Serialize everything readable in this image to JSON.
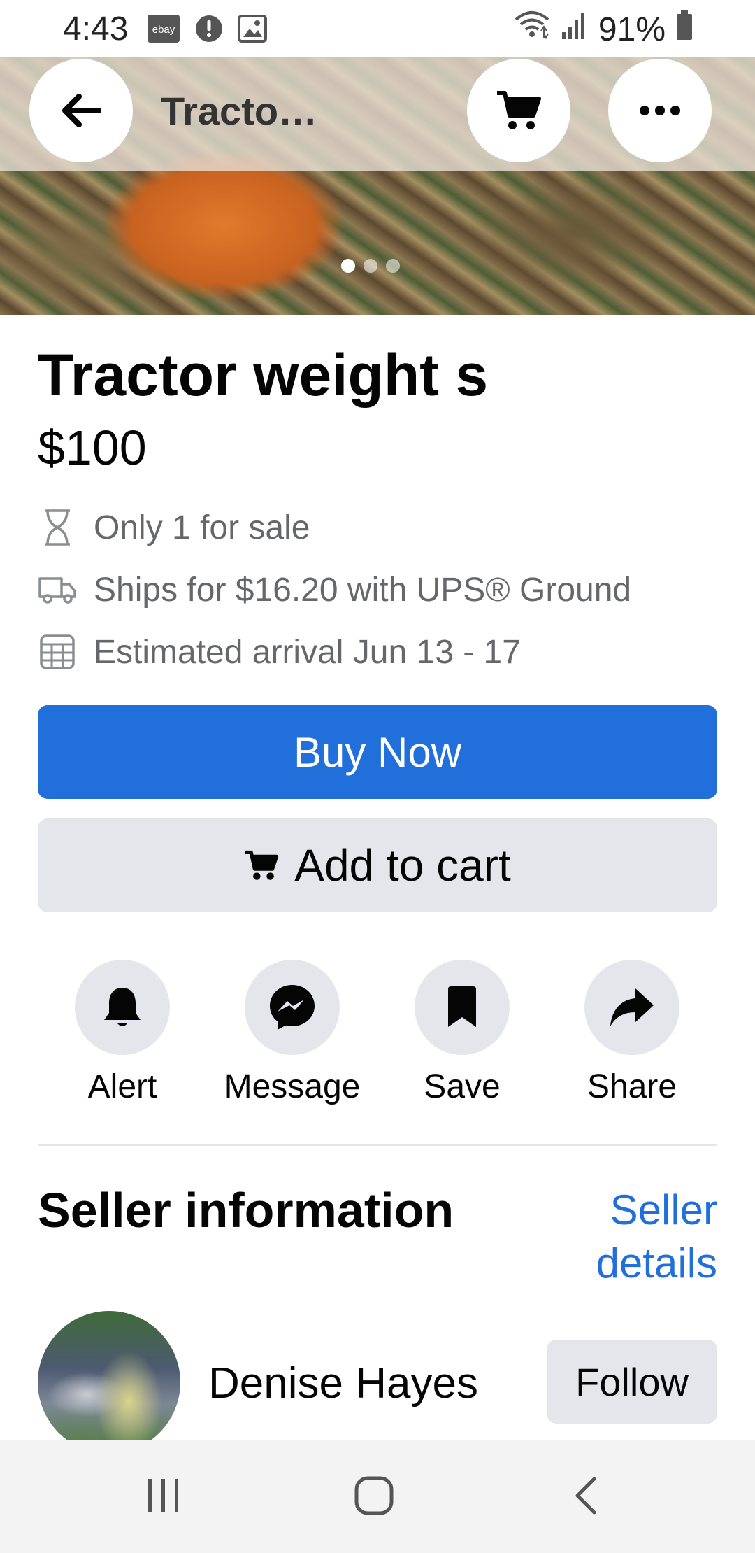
{
  "status_bar": {
    "time": "4:43",
    "battery": "91%",
    "app_badge": "ebay"
  },
  "header": {
    "title": "Tracto…"
  },
  "hero": {
    "image_count": 3,
    "active_index": 0
  },
  "product": {
    "title": "Tractor weight s",
    "price": "$100",
    "availability": "Only 1 for sale",
    "shipping": "Ships for $16.20 with UPS® Ground",
    "arrival": "Estimated arrival Jun 13 - 17"
  },
  "buttons": {
    "buy_now": "Buy Now",
    "add_to_cart": "Add to cart"
  },
  "actions": [
    {
      "label": "Alert",
      "icon": "bell-icon"
    },
    {
      "label": "Message",
      "icon": "messenger-icon"
    },
    {
      "label": "Save",
      "icon": "bookmark-icon"
    },
    {
      "label": "Share",
      "icon": "share-arrow-icon"
    }
  ],
  "seller": {
    "section_title": "Seller information",
    "details_link": "Seller details",
    "name": "Denise Hayes",
    "follow_label": "Follow"
  },
  "colors": {
    "accent": "#216fdb",
    "button_gray": "#e4e6eb",
    "secondary_text": "#65676b"
  }
}
